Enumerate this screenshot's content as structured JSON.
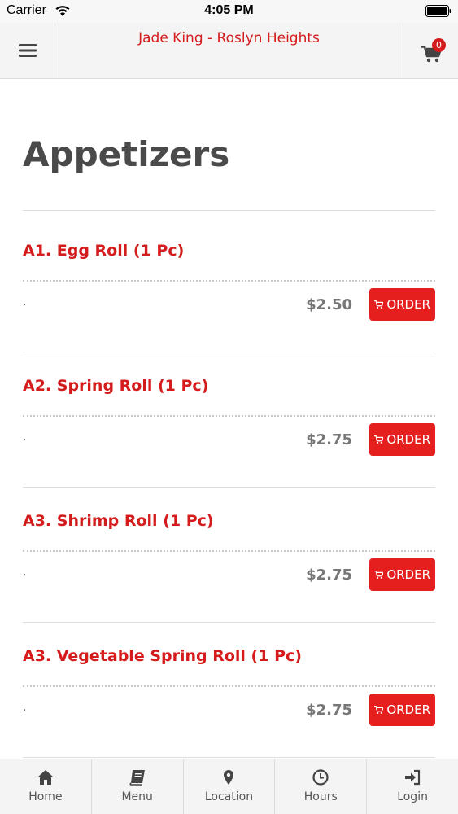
{
  "status_bar": {
    "carrier": "Carrier",
    "time": "4:05 PM"
  },
  "header": {
    "title": "Jade King - Roslyn Heights",
    "cart_count": "0"
  },
  "page": {
    "title": "Appetizers"
  },
  "items": [
    {
      "name": "A1. Egg Roll (1 Pc)",
      "description": ".",
      "price": "$2.50",
      "order_label": "ORDER"
    },
    {
      "name": "A2. Spring Roll (1 Pc)",
      "description": ".",
      "price": "$2.75",
      "order_label": "ORDER"
    },
    {
      "name": "A3. Shrimp Roll (1 Pc)",
      "description": ".",
      "price": "$2.75",
      "order_label": "ORDER"
    },
    {
      "name": "A3. Vegetable Spring Roll (1 Pc)",
      "description": ".",
      "price": "$2.75",
      "order_label": "ORDER"
    }
  ],
  "bottom_nav": [
    {
      "label": "Home",
      "icon": "home-icon"
    },
    {
      "label": "Menu",
      "icon": "book-icon"
    },
    {
      "label": "Location",
      "icon": "map-pin-icon"
    },
    {
      "label": "Hours",
      "icon": "clock-icon"
    },
    {
      "label": "Login",
      "icon": "login-icon"
    }
  ],
  "colors": {
    "brand_red": "#d51c1c",
    "order_button": "#e51e1e",
    "header_bg": "#f4f4f4"
  }
}
